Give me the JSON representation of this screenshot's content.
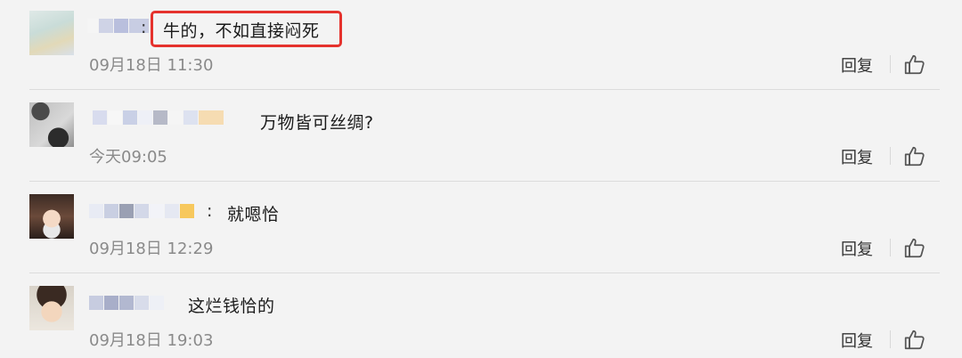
{
  "comments": [
    {
      "author_mosaic_colors": [
        "#f5f5f5",
        "#cfd3e6",
        "#b9bfdd",
        "#c8cde3"
      ],
      "text": "牛的，不如直接闷死",
      "time": "09月18日 11:30",
      "reply_label": "回复",
      "highlighted": true
    },
    {
      "author_mosaic_colors": [
        "#d8dcee",
        "#f7f7f7",
        "#c9d0e6",
        "#eef0f7",
        "#b6b9c7",
        "#f5f5f5",
        "#dde2f0",
        "#f6dcb2"
      ],
      "text": "万物皆可丝绸?",
      "time": "今天09:05",
      "reply_label": "回复"
    },
    {
      "author_mosaic_colors": [
        "#e8ebf4",
        "#c9cfe2",
        "#9aa0b3",
        "#d3d8e8",
        "#f2f3f8",
        "#e5e8f2",
        "#f7c85d"
      ],
      "text": "就嗯恰",
      "time": "09月18日 12:29",
      "reply_label": "回复"
    },
    {
      "author_mosaic_colors": [
        "#c7cce0",
        "#a8aec9",
        "#b2b8d0",
        "#d8dcea",
        "#eef0f6"
      ],
      "text": "这烂钱恰的",
      "time": "09月18日 19:03",
      "reply_label": "回复"
    }
  ],
  "icons": {
    "like": "thumbs-up-icon",
    "avatar": "avatar"
  },
  "colors": {
    "highlight_border": "#e5322d",
    "timestamp": "#8a8a8a",
    "background": "#f3f3f3"
  }
}
